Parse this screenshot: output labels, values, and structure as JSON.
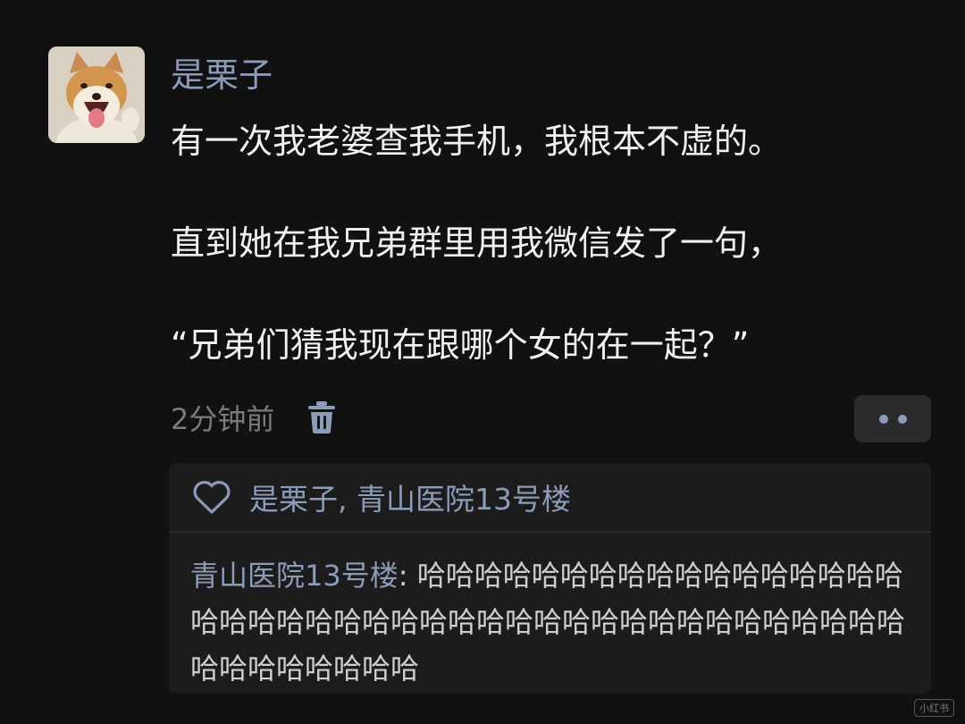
{
  "post": {
    "avatar_icon": "shiba-dog-avatar",
    "username": "是栗子",
    "lines": [
      "有一次我老婆查我手机，我根本不虚的。",
      "直到她在我兄弟群里用我微信发了一句，",
      "“兄弟们猜我现在跟哪个女的在一起？”"
    ],
    "time": "2分钟前",
    "delete_icon": "trash-icon",
    "more_icon": "more-dots-icon"
  },
  "likes": {
    "icon": "heart-icon",
    "names": "是栗子, 青山医院13号楼"
  },
  "comments": [
    {
      "author": "青山医院13号楼",
      "separator": ": ",
      "text": "哈哈哈哈哈哈哈哈哈哈哈哈哈哈哈哈哈哈哈哈哈哈哈哈哈哈哈哈哈哈哈哈哈哈哈哈哈哈哈哈哈哈哈哈哈哈哈哈哈哈"
    }
  ],
  "watermark": "小红书"
}
